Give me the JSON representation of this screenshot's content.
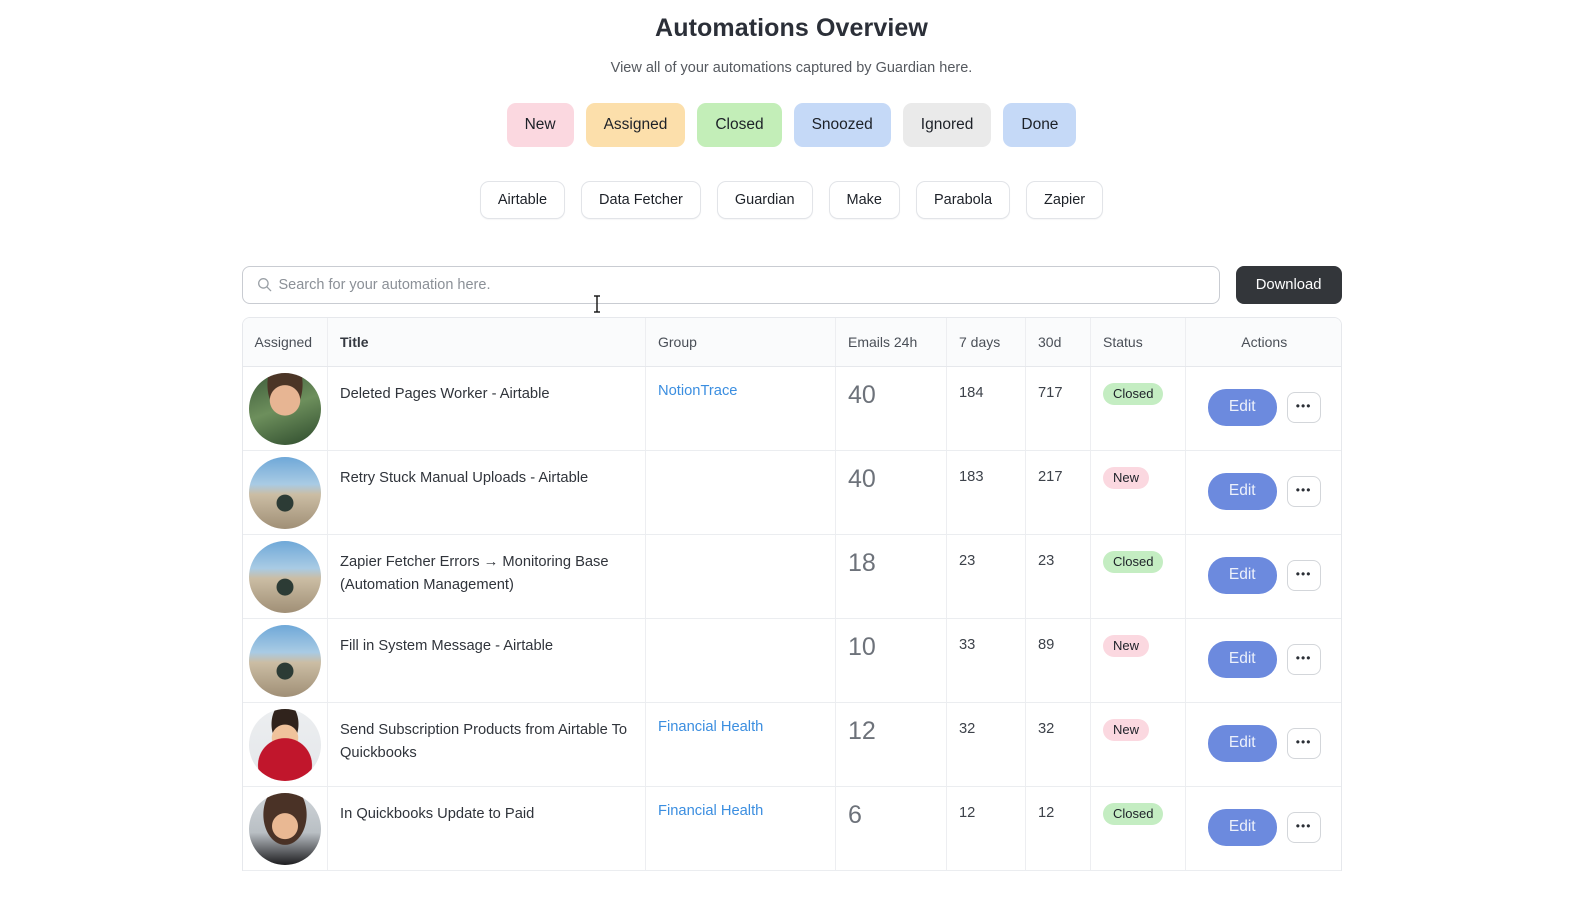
{
  "header": {
    "title": "Automations Overview",
    "subtitle": "View all of your automations captured by Guardian here."
  },
  "status_tabs": [
    {
      "label": "New",
      "color": "#fbd8e0"
    },
    {
      "label": "Assigned",
      "color": "#fcdfab"
    },
    {
      "label": "Closed",
      "color": "#c3eeb8"
    },
    {
      "label": "Snoozed",
      "color": "#c5d9f7"
    },
    {
      "label": "Ignored",
      "color": "#eaeaea"
    },
    {
      "label": "Done",
      "color": "#c5d9f7"
    }
  ],
  "source_chips": [
    {
      "label": "Airtable"
    },
    {
      "label": "Data Fetcher"
    },
    {
      "label": "Guardian"
    },
    {
      "label": "Make"
    },
    {
      "label": "Parabola"
    },
    {
      "label": "Zapier"
    }
  ],
  "search": {
    "placeholder": "Search for your automation here.",
    "value": "",
    "icon": "search-icon"
  },
  "download_button": {
    "label": "Download"
  },
  "table": {
    "columns": [
      {
        "key": "assigned",
        "label": "Assigned"
      },
      {
        "key": "title",
        "label": "Title"
      },
      {
        "key": "group",
        "label": "Group"
      },
      {
        "key": "emails24",
        "label": "Emails 24h"
      },
      {
        "key": "days7",
        "label": "7 days"
      },
      {
        "key": "days30",
        "label": "30d"
      },
      {
        "key": "status",
        "label": "Status"
      },
      {
        "key": "actions",
        "label": "Actions"
      }
    ],
    "row_actions": {
      "edit_label": "Edit",
      "more_label": "•••"
    },
    "rows": [
      {
        "avatar": "photo-man",
        "title": "Deleted Pages Worker - Airtable",
        "group": "NotionTrace",
        "emails24": "40",
        "days7": "184",
        "days30": "717",
        "status": "Closed",
        "status_kind": "closed"
      },
      {
        "avatar": "desert",
        "title": "Retry Stuck Manual Uploads - Airtable",
        "group": "",
        "emails24": "40",
        "days7": "183",
        "days30": "217",
        "status": "New",
        "status_kind": "new"
      },
      {
        "avatar": "desert",
        "title": "Zapier Fetcher Errors → Monitoring Base (Automation Management)",
        "group": "",
        "emails24": "18",
        "days7": "23",
        "days30": "23",
        "status": "Closed",
        "status_kind": "closed"
      },
      {
        "avatar": "desert",
        "title": "Fill in System Message - Airtable",
        "group": "",
        "emails24": "10",
        "days7": "33",
        "days30": "89",
        "status": "New",
        "status_kind": "new"
      },
      {
        "avatar": "cartoon",
        "title": "Send Subscription Products from Airtable To Quickbooks",
        "group": "Financial Health",
        "emails24": "12",
        "days7": "32",
        "days30": "32",
        "status": "New",
        "status_kind": "new"
      },
      {
        "avatar": "woman",
        "title": "In Quickbooks Update to Paid",
        "group": "Financial Health",
        "emails24": "6",
        "days7": "12",
        "days30": "12",
        "status": "Closed",
        "status_kind": "closed"
      }
    ]
  },
  "colors": {
    "accent_blue": "#6c8ade",
    "link_blue": "#3b8ee0",
    "download_dark": "#33363a",
    "badge_closed": "#c4edc2",
    "badge_new": "#fbd8e0"
  }
}
